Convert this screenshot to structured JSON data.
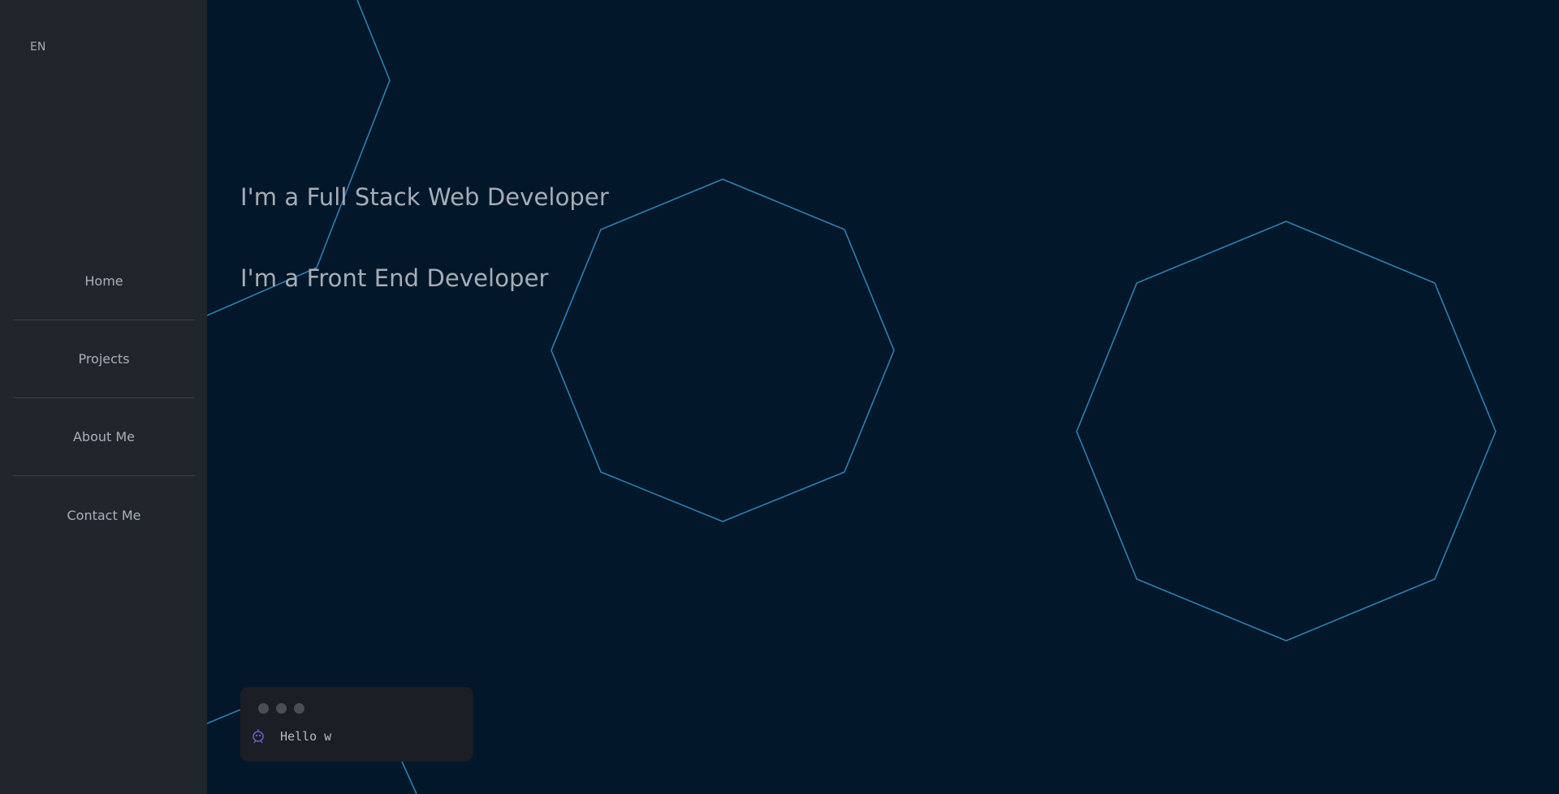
{
  "sidebar": {
    "language": "EN",
    "nav_items": [
      {
        "label": "Home"
      },
      {
        "label": "Projects"
      },
      {
        "label": "About Me"
      },
      {
        "label": "Contact Me"
      }
    ]
  },
  "hero": {
    "headline_1": "I'm a Full Stack Web Developer",
    "headline_2": "I'm a Front End Developer"
  },
  "terminal": {
    "icon": "alien-robot-icon",
    "text": "Hello w"
  },
  "colors": {
    "background": "#02172a",
    "sidebar": "#21252c",
    "outline": "#2f7fb5",
    "text": "#a7adb6"
  }
}
